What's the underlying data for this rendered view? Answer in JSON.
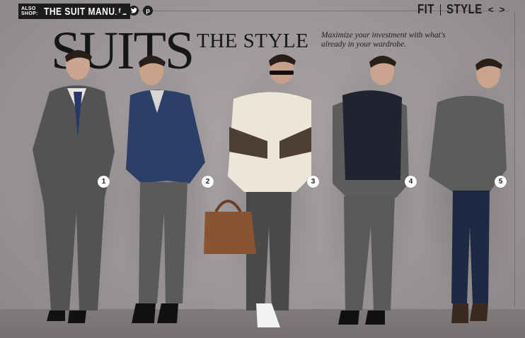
{
  "header": {
    "also_shop": "ALSO SHOP:",
    "suit_manual": "THE SUIT MANUAL",
    "social": [
      "f",
      "t",
      "p"
    ]
  },
  "nav": {
    "fit": "FIT",
    "style": "STYLE",
    "prev": "<",
    "next": ">"
  },
  "title": {
    "big": "SUITS",
    "small": "THE STYLE",
    "tagline": "Maximize your investment with what's already in your wardrobe."
  },
  "looks": [
    "1",
    "2",
    "3",
    "4",
    "5"
  ],
  "colors": {
    "background": "#9b9697",
    "ink": "#1c1c1c"
  }
}
